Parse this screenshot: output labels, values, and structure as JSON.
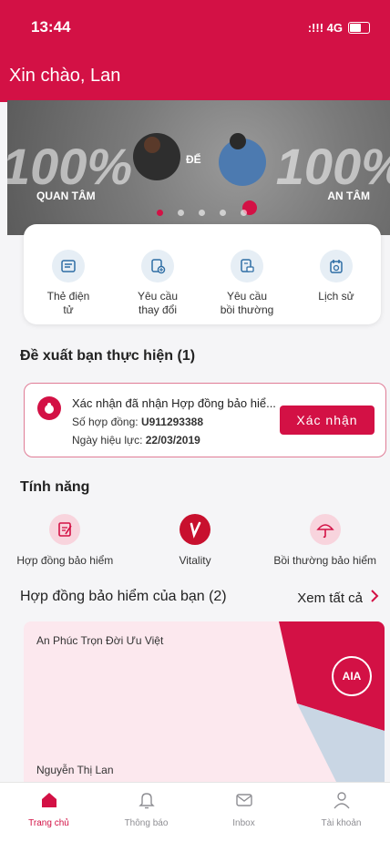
{
  "status_bar": {
    "time": "13:44",
    "signal": ":!!! 4G"
  },
  "header": {
    "greeting": "Xin chào, Lan"
  },
  "banner": {
    "left_big": "100%",
    "right_big": "100%",
    "left_caption": "QUAN TÂM",
    "middle_caption": "ĐỂ",
    "right_caption": "AN TÂM",
    "dot_count": 5,
    "active_dot": 0
  },
  "quick_actions": [
    {
      "label1": "Thẻ điện",
      "label2": "tử",
      "icon": "card-icon"
    },
    {
      "label1": "Yêu cầu",
      "label2": "thay đổi",
      "icon": "document-add-icon"
    },
    {
      "label1": "Yêu cầu",
      "label2": "bồi thường",
      "icon": "claim-icon"
    },
    {
      "label1": "Lịch sử",
      "label2": "",
      "icon": "calendar-icon"
    }
  ],
  "suggestions": {
    "title": "Đề xuất bạn thực hiện (1)",
    "item": {
      "title": "Xác nhận đã nhận Hợp đồng bảo hiể...",
      "contract_label": "Số hợp đồng: ",
      "contract_no": "U911293388",
      "date_label": "Ngày hiệu lực: ",
      "date": "22/03/2019",
      "button": "Xác nhận"
    }
  },
  "features": {
    "title": "Tính năng",
    "items": [
      {
        "label": "Hợp đồng bảo hiểm",
        "icon": "contract-icon"
      },
      {
        "label": "Vitality",
        "icon": "vitality-icon"
      },
      {
        "label": "Bồi thường bảo hiểm",
        "icon": "umbrella-icon"
      }
    ]
  },
  "contracts": {
    "title": "Hợp đồng bảo hiểm của bạn (2)",
    "see_all": "Xem tất cả",
    "card": {
      "product": "An Phúc Trọn Đời Ưu Việt",
      "owner": "Nguyễn Thị Lan",
      "logo": "AIA"
    }
  },
  "tabbar": [
    {
      "label": "Trang chủ",
      "icon": "home-icon",
      "active": true
    },
    {
      "label": "Thông báo",
      "icon": "bell-icon",
      "active": false
    },
    {
      "label": "Inbox",
      "icon": "mail-icon",
      "active": false
    },
    {
      "label": "Tài khoản",
      "icon": "user-icon",
      "active": false
    }
  ],
  "colors": {
    "brand": "#d31145",
    "background": "#f5f5f7"
  }
}
